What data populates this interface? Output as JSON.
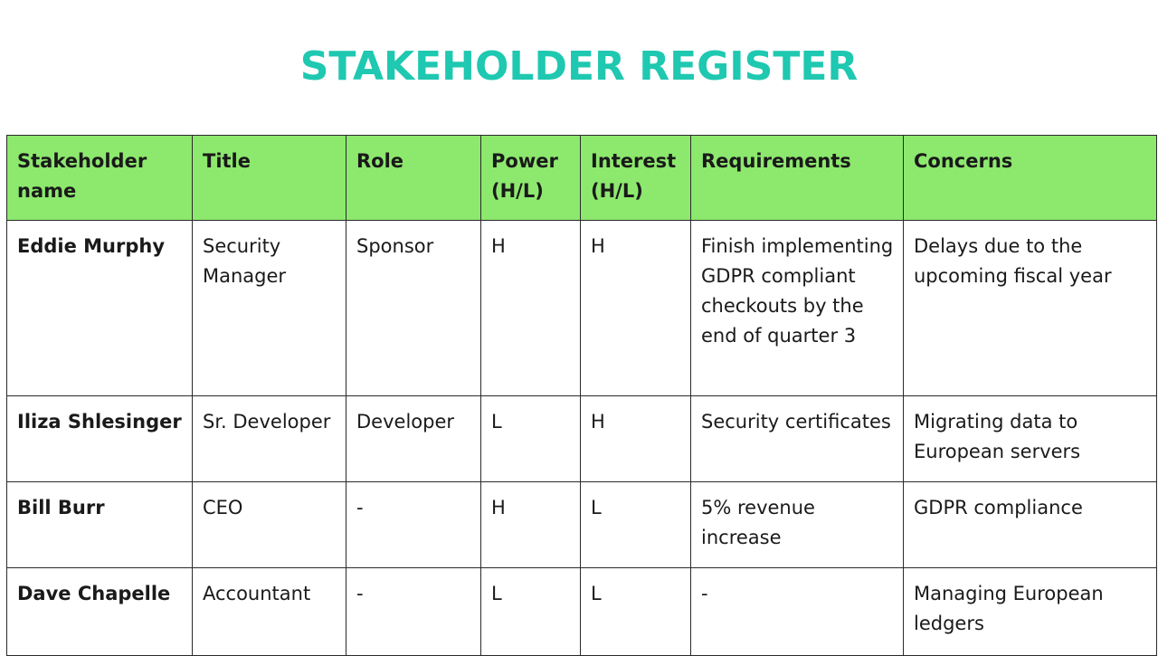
{
  "title": "STAKEHOLDER REGISTER",
  "colors": {
    "title": "#1fc8b0",
    "header_bg": "#8de86e",
    "border": "#2a2a2a"
  },
  "table": {
    "headers": [
      "Stakeholder name",
      "Title",
      "Role",
      "Power (H/L)",
      "Interest (H/L)",
      "Requirements",
      "Concerns"
    ],
    "rows": [
      {
        "name": "Eddie Murphy",
        "title": "Security Manager",
        "role": "Sponsor",
        "power": "H",
        "interest": "H",
        "requirements": "Finish implementing GDPR compliant checkouts by the end of quarter 3",
        "concerns": "Delays due to the upcoming fiscal year"
      },
      {
        "name": "Iliza Shlesinger",
        "title": "Sr. Developer",
        "role": "Developer",
        "power": "L",
        "interest": "H",
        "requirements": "Security certificates",
        "concerns": "Migrating data to European servers"
      },
      {
        "name": "Bill Burr",
        "title": "CEO",
        "role": "-",
        "power": "H",
        "interest": "L",
        "requirements": "5% revenue increase",
        "concerns": "GDPR compliance"
      },
      {
        "name": "Dave Chapelle",
        "title": "Accountant",
        "role": "-",
        "power": "L",
        "interest": "L",
        "requirements": "-",
        "concerns": "Managing European ledgers"
      }
    ]
  }
}
